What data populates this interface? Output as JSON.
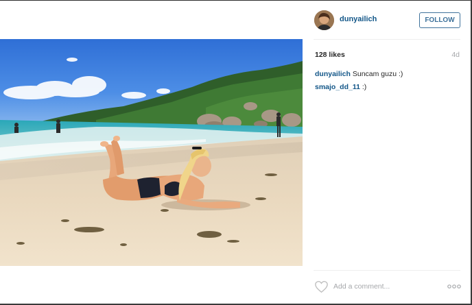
{
  "post": {
    "username": "dunyailich",
    "follow_label": "FOLLOW",
    "likes": "128 likes",
    "time": "4d",
    "comments": [
      {
        "author": "dunyailich",
        "text": "Suncam guzu :)"
      },
      {
        "author": "smajo_dd_11",
        "text": ":)"
      }
    ],
    "add_comment_placeholder": "Add a comment...",
    "more_options_label": "ooo"
  },
  "colors": {
    "link_blue": "#125688",
    "follow_blue": "#3f729b",
    "muted_gray": "#a5a7aa",
    "text_dark": "#262626"
  },
  "icons": {
    "heart": "heart-outline-icon",
    "more": "more-options-icon"
  }
}
